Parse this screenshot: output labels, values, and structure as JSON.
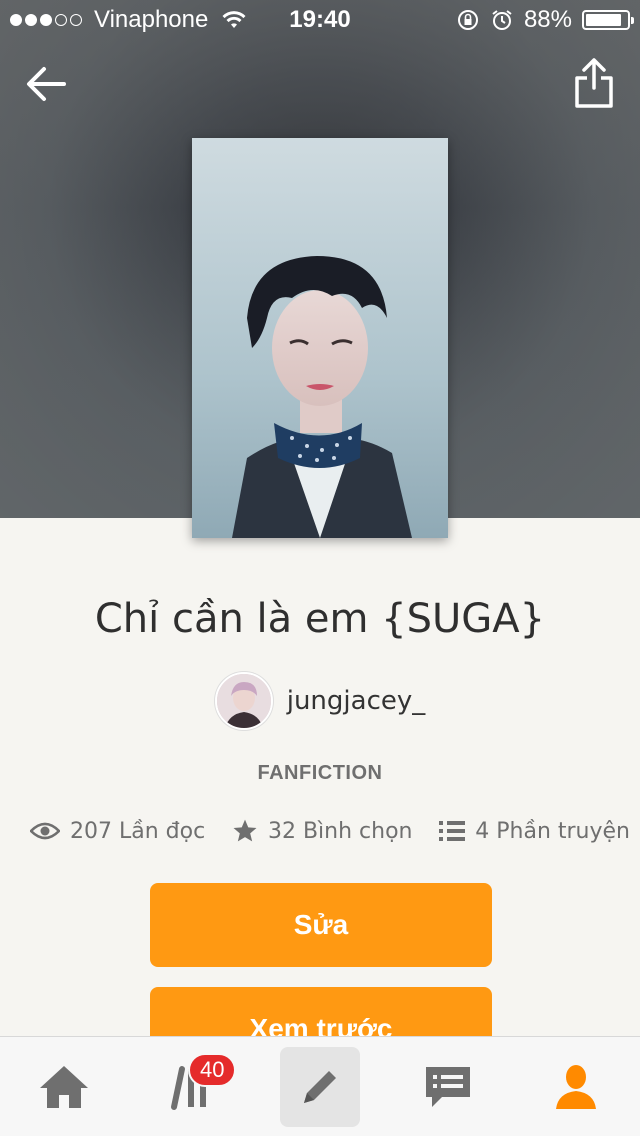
{
  "status_bar": {
    "carrier": "Vinaphone",
    "time": "19:40",
    "battery": "88%",
    "battery_level": 0.88
  },
  "story": {
    "title": "Chỉ cần là em {SUGA}",
    "author": "jungjacey_",
    "category": "FANFICTION",
    "stats": {
      "reads": "207 Lần đọc",
      "votes": "32 Bình chọn",
      "parts": "4 Phần truyện"
    }
  },
  "actions": {
    "edit_label": "Sửa",
    "preview_label": "Xem trước"
  },
  "tabbar": {
    "library_badge": "40"
  },
  "colors": {
    "accent": "#ff9912",
    "badge": "#e52b2b",
    "icon_gray": "#6f6f6f"
  },
  "icons": [
    "back-arrow-icon",
    "share-icon",
    "eye-icon",
    "star-icon",
    "list-icon",
    "home-icon",
    "library-icon",
    "pencil-icon",
    "messages-icon",
    "profile-icon"
  ]
}
